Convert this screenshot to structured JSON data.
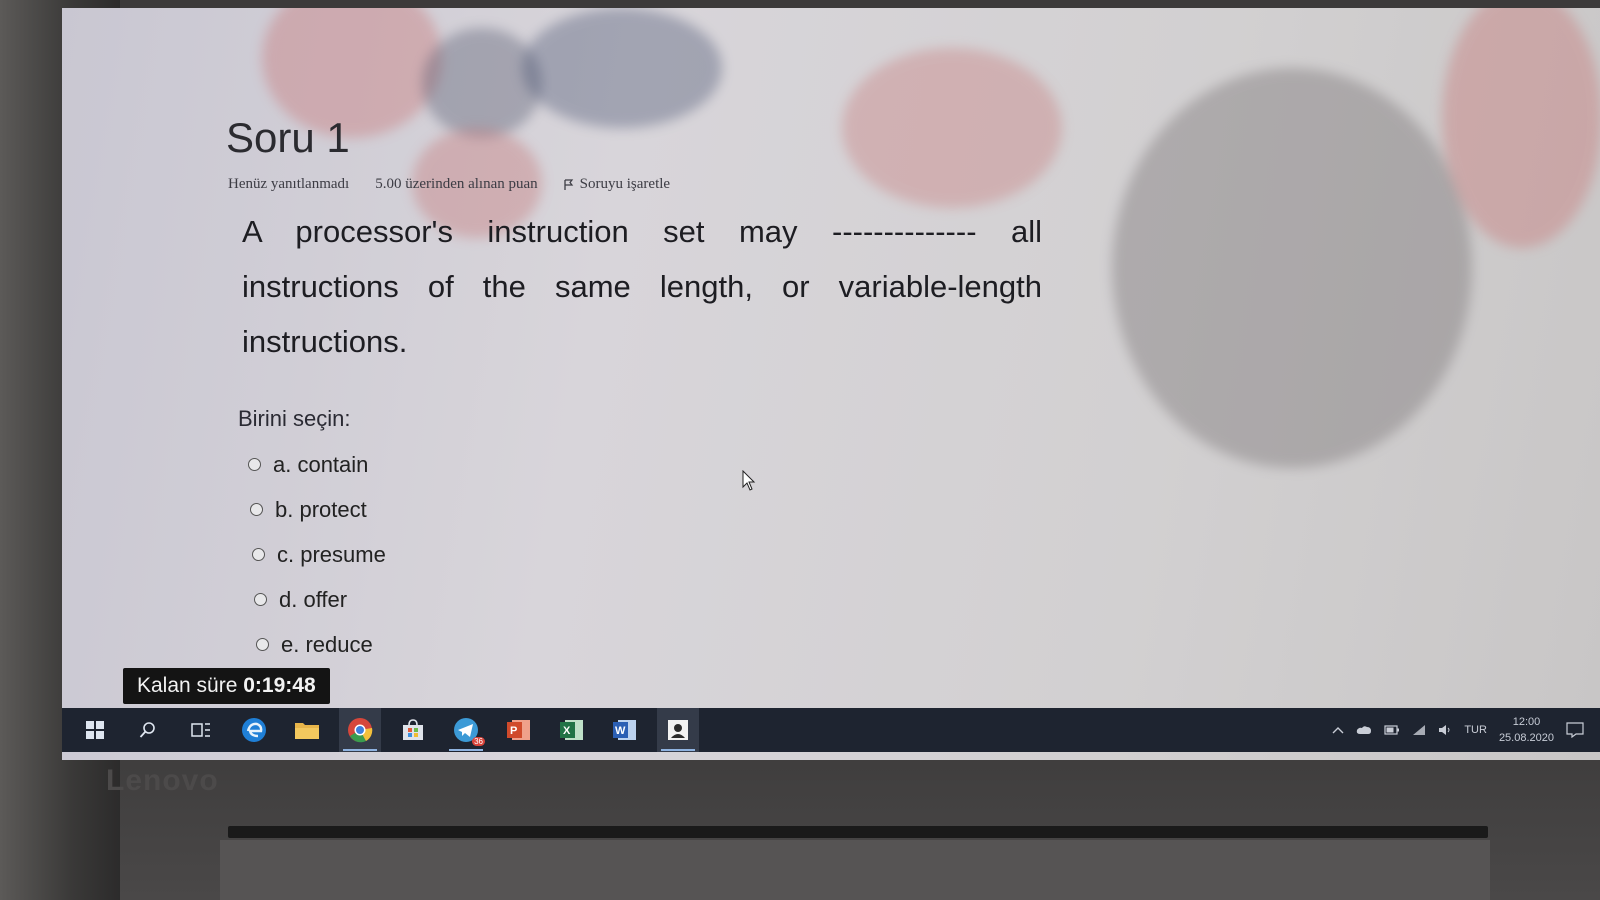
{
  "question": {
    "title": "Soru 1",
    "status": "Henüz yanıtlanmadı",
    "points": "5.00 üzerinden alınan puan",
    "flag_label": "Soruyu işaretle",
    "text": "A processor's instruction set may -------------- all instructions of the same length, or variable-length instructions.",
    "prompt": "Birini seçin:",
    "options": [
      {
        "label": "a. contain"
      },
      {
        "label": "b. protect"
      },
      {
        "label": "c. presume"
      },
      {
        "label": "d. offer"
      },
      {
        "label": "e. reduce"
      }
    ]
  },
  "timer": {
    "label": "Kalan süre",
    "value": "0:19:48"
  },
  "taskbar": {
    "icons": [
      "windows-start",
      "search",
      "task-view",
      "edge",
      "file-explorer",
      "chrome",
      "store",
      "telegram",
      "powerpoint",
      "excel",
      "word",
      "contacts-app"
    ],
    "telegram_badge": "36",
    "tray": {
      "language": "TUR",
      "time": "12:00",
      "date": "25.08.2020"
    }
  },
  "device": {
    "brand": "Lenovo"
  },
  "colors": {
    "taskbar": "#1e2430",
    "timer_bg": "#141414",
    "screen_bg": "#d5d3d8"
  }
}
